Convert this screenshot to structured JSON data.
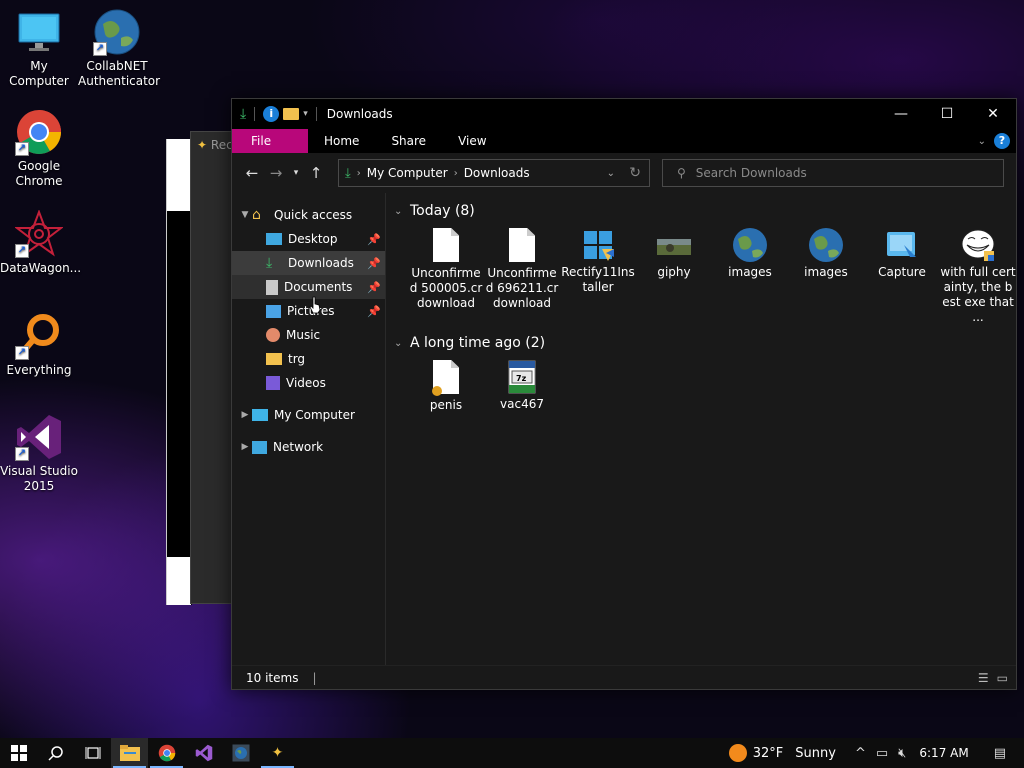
{
  "desktop": {
    "icons": [
      {
        "label": "My Computer",
        "icon": "monitor-icon"
      },
      {
        "label": "CollabNET Authenticator",
        "icon": "globe-icon"
      },
      {
        "label": "Google Chrome",
        "icon": "chrome-icon"
      },
      {
        "label": "DataWagon...",
        "icon": "datawagon-icon"
      },
      {
        "label": "Everything",
        "icon": "magnifier-icon"
      },
      {
        "label": "Visual Studio 2015",
        "icon": "visual-studio-icon"
      }
    ]
  },
  "bg_window": {
    "title": "Rec"
  },
  "explorer": {
    "title": "Downloads",
    "ribbon": {
      "file": "File",
      "home": "Home",
      "share": "Share",
      "view": "View",
      "help": "?"
    },
    "address": {
      "crumbs": [
        "My Computer",
        "Downloads"
      ]
    },
    "search": {
      "placeholder": "Search Downloads"
    },
    "nav": {
      "quick_access": "Quick access",
      "items": [
        "Desktop",
        "Downloads",
        "Documents",
        "Pictures",
        "Music",
        "trg",
        "Videos"
      ],
      "my_computer": "My Computer",
      "network": "Network"
    },
    "groups": [
      {
        "header": "Today (8)",
        "files": [
          {
            "name": "Unconfirmed 500005.crdownload",
            "icon": "document-icon"
          },
          {
            "name": "Unconfirmed 696211.crdownload",
            "icon": "document-icon"
          },
          {
            "name": "Rectify11Installer",
            "icon": "installer-icon"
          },
          {
            "name": "giphy",
            "icon": "image-thumbnail-icon"
          },
          {
            "name": "images",
            "icon": "globe-icon"
          },
          {
            "name": "images",
            "icon": "globe-icon"
          },
          {
            "name": "Capture",
            "icon": "capture-icon"
          },
          {
            "name": "with full certainty, the best exe that ...",
            "icon": "trollface-icon"
          }
        ]
      },
      {
        "header": "A long time ago (2)",
        "files": [
          {
            "name": "penis",
            "icon": "document-icon"
          },
          {
            "name": "vac467",
            "icon": "archive-icon"
          }
        ]
      }
    ],
    "status": {
      "count": "10 items"
    }
  },
  "taskbar": {
    "weather": {
      "temp": "32°F",
      "condition": "Sunny"
    },
    "time": "6:17 AM"
  },
  "colors": {
    "file_tab": "#b8077a",
    "accent": "#1a7fd8"
  }
}
